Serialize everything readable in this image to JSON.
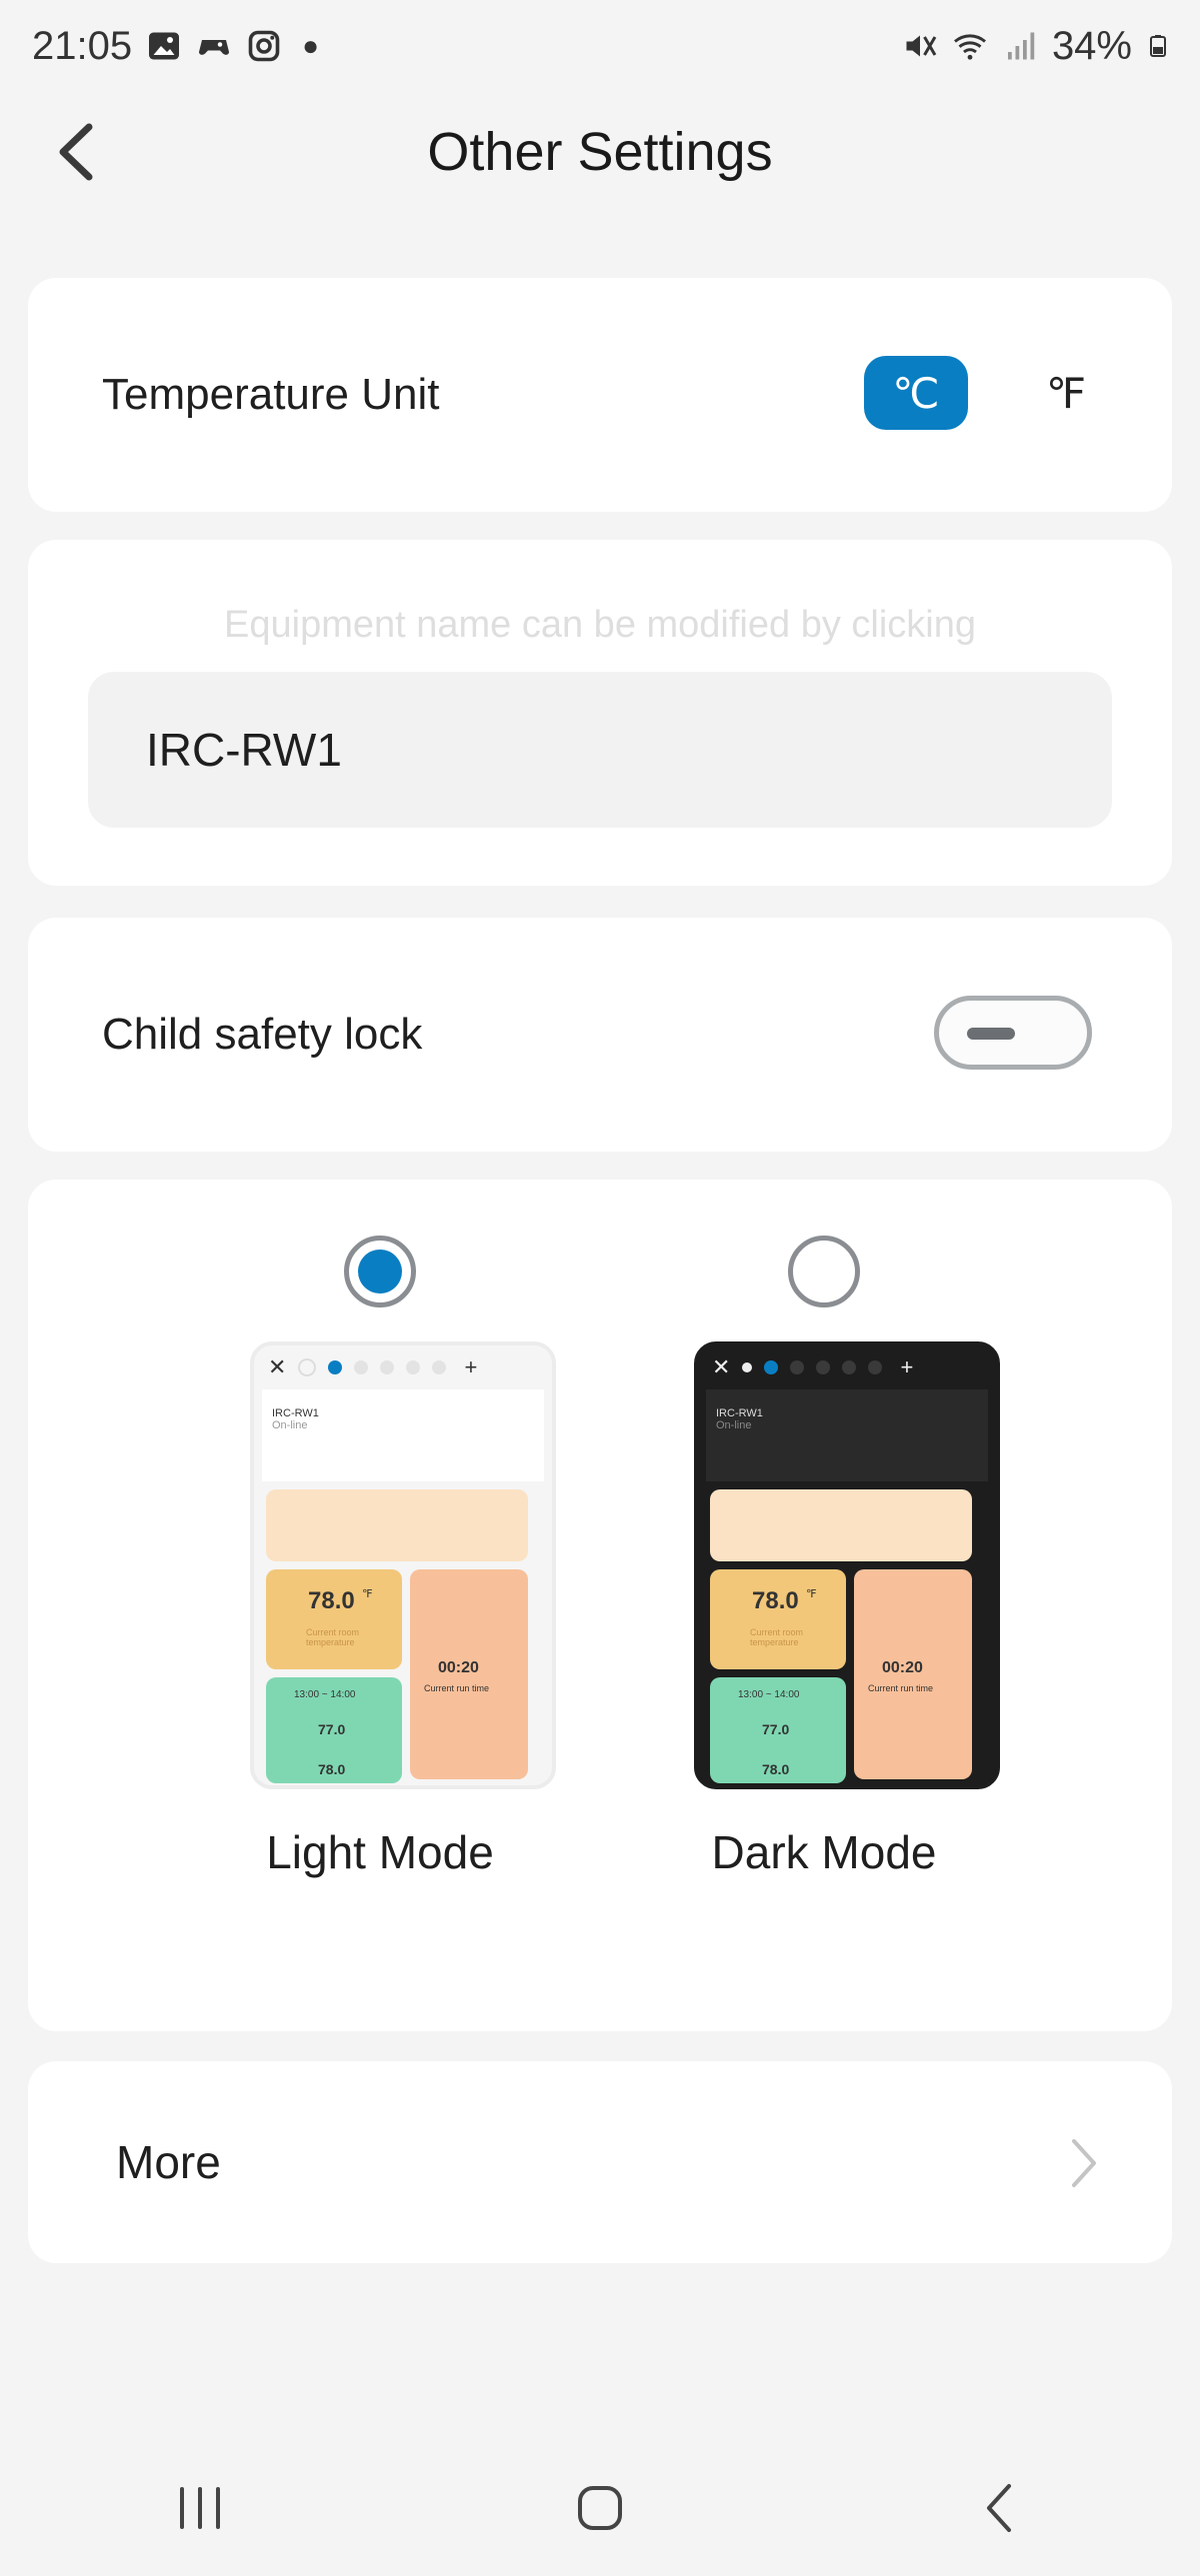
{
  "status_bar": {
    "time": "21:05",
    "battery": "34%"
  },
  "header": {
    "title": "Other Settings"
  },
  "temperature": {
    "label": "Temperature Unit",
    "celsius": "℃",
    "fahrenheit": "℉",
    "selected": "celsius"
  },
  "equipment": {
    "hint": "Equipment name can be modified by clicking",
    "name": "IRC-RW1"
  },
  "child_lock": {
    "label": "Child safety lock",
    "enabled": false
  },
  "theme": {
    "selected": "light",
    "light_label": "Light Mode",
    "dark_label": "Dark Mode",
    "preview": {
      "device_name": "IRC-RW1",
      "device_status": "On-line",
      "current_temp": "78.0",
      "current_temp_unit": "℉",
      "current_temp_caption": "Current room temperature",
      "run_time": "00:20",
      "run_time_caption": "Current run time",
      "schedule": "13:00 ~ 14:00",
      "range_low": "77.0",
      "range_high": "78.0"
    }
  },
  "more": {
    "label": "More"
  },
  "colors": {
    "accent": "#0a7ec2",
    "card": "#ffffff",
    "background": "#f4f4f4"
  }
}
